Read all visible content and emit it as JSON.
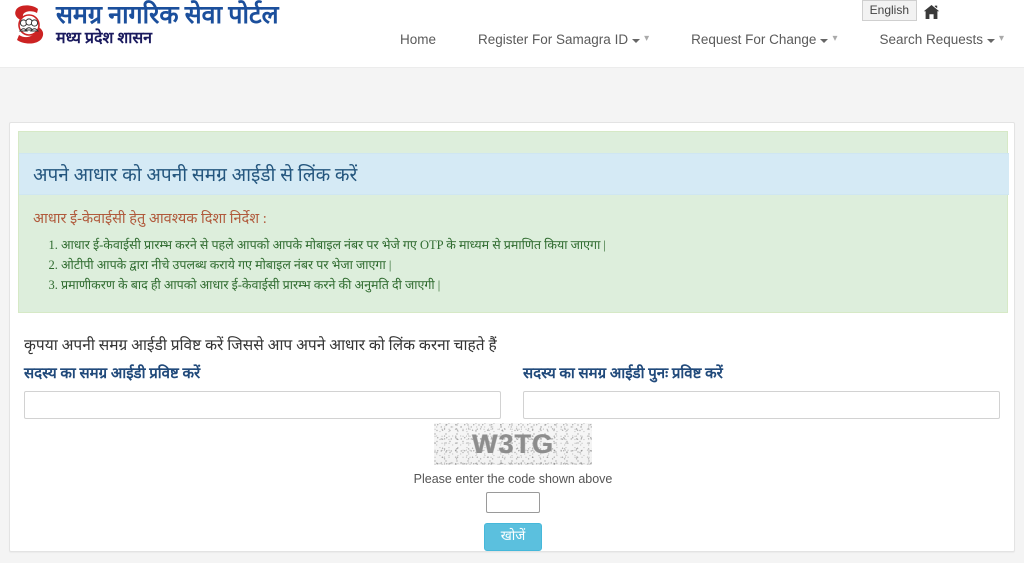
{
  "header": {
    "brand": {
      "title": "समग्र नागरिक सेवा पोर्टल",
      "subtitle": "मध्य प्रदेश शासन",
      "logo_icon": "samagra-family-s-logo"
    },
    "language_button": "English",
    "home_icon": "home-icon",
    "nav": [
      {
        "label": "Home",
        "has_dropdown": false
      },
      {
        "label": "Register For Samagra ID",
        "has_dropdown": true
      },
      {
        "label": "Request For Change",
        "has_dropdown": true
      },
      {
        "label": "Search Requests",
        "has_dropdown": true
      }
    ]
  },
  "panel": {
    "heading": "अपने आधार को अपनी समग्र आईडी से लिंक करें",
    "guidelines_title": "आधार ई-केवाईसी हेतु आवश्यक दिशा निर्देश :",
    "guidelines": [
      "आधार ई-केवाईसी प्रारम्भ करने से पहले आपको आपके मोबाइल नंबर पर भेजे गए OTP के माध्यम से प्रमाणित किया जाएगा |",
      "ओटीपी आपके द्वारा नीचे उपलब्ध कराये गए मोबाइल नंबर पर भेजा जाएगा |",
      "प्रमाणीकरण के बाद ही आपको आधार ई-केवाईसी प्रारम्भ करने की अनुमति दी जाएगी |"
    ],
    "form_intro": "कृपया अपनी समग्र आईडी प्रविष्ट करें जिससे आप अपने आधार को लिंक करना चाहते हैं",
    "fields": {
      "samagra_id": {
        "label": "सदस्य का समग्र आईडी प्रविष्ट करें",
        "value": "",
        "placeholder": ""
      },
      "samagra_id_confirm": {
        "label": "सदस्य का समग्र आईडी पुनः प्रविष्ट करें",
        "value": "",
        "placeholder": ""
      }
    },
    "captcha": {
      "code_image_text": "W3TG",
      "help_text": "Please enter the code shown above",
      "input_value": "",
      "input_placeholder": ""
    },
    "submit_button": "खोजें"
  },
  "colors": {
    "brand_blue": "#1b4f9c",
    "brand_red": "#cc2222",
    "alert_green_bg": "#ddeedc",
    "alert_blue_bg": "#d5eaf5",
    "heading_text": "#24567e",
    "guideline_title": "#b05a3c",
    "guideline_text": "#2f6b2f",
    "label_blue": "#214a7b",
    "button_blue": "#5bc0de",
    "page_bg": "#f4f4f4"
  }
}
